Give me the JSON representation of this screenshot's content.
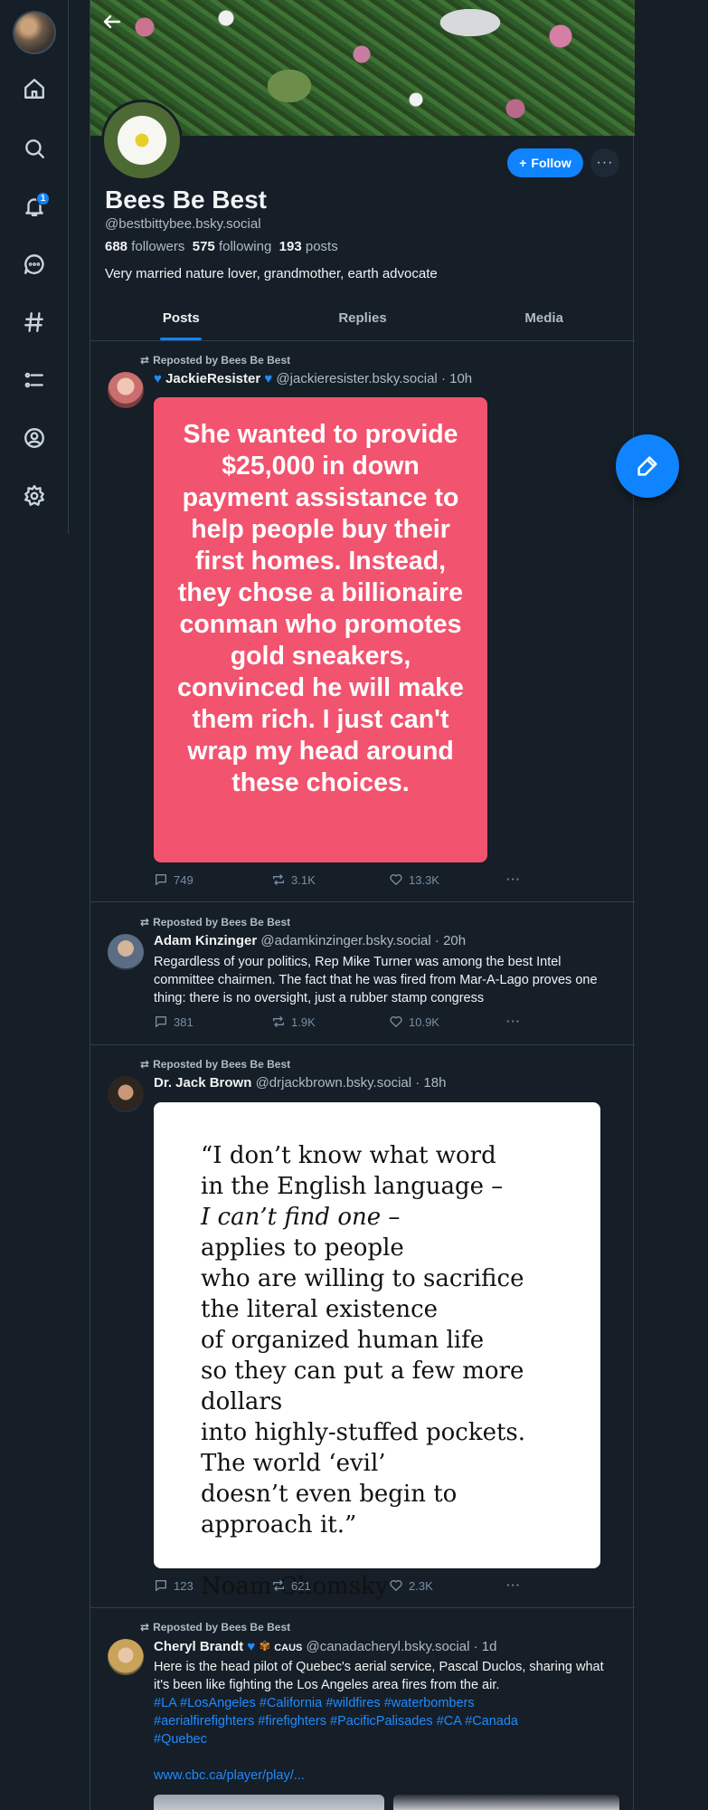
{
  "sidebar": {
    "notifications_count": "1"
  },
  "profile": {
    "display_name": "Bees Be Best",
    "handle": "@bestbittybee.bsky.social",
    "followers_count": "688",
    "followers_label": "followers",
    "following_count": "575",
    "following_label": "following",
    "posts_count": "193",
    "posts_label": "posts",
    "bio": "Very married nature lover, grandmother, earth advocate",
    "follow_label": "Follow",
    "more_label": "···"
  },
  "tabs": [
    "Posts",
    "Replies",
    "Media"
  ],
  "repost_label": "Reposted by Bees Be Best",
  "posts": [
    {
      "name": "JackieResister",
      "handle": "@jackieresister.bsky.social",
      "time": "· 10h",
      "image_text": "She wanted to provide $25,000 in down payment assistance to help people buy their first homes. Instead, they chose a billionaire conman who promotes gold sneakers, convinced he will make them rich. I just can't wrap my head around these choices.",
      "replies": "749",
      "reposts": "3.1K",
      "likes": "13.3K"
    },
    {
      "name": "Adam Kinzinger",
      "handle": "@adamkinzinger.bsky.social",
      "time": "· 20h",
      "text": "Regardless of your politics, Rep Mike Turner was among the best Intel committee chairmen.  The fact that he was fired from Mar-A-Lago proves one thing:  there is no oversight, just a rubber stamp congress",
      "replies": "381",
      "reposts": "1.9K",
      "likes": "10.9K"
    },
    {
      "name": "Dr. Jack Brown",
      "handle": "@drjackbrown.bsky.social",
      "time": "· 18h",
      "quote_lines": [
        "“I don’t know what word",
        "in the English language –",
        "I can’t find one –",
        "applies to people",
        "who are willing to sacrifice",
        "the literal existence",
        "of organized human life",
        "so they can put a few more dollars",
        "into highly-stuffed pockets.",
        "The world ‘evil’",
        "doesn’t even begin to approach it.”"
      ],
      "quote_author": "Noam Chomsky",
      "replies": "123",
      "reposts": "621",
      "likes": "2.3K"
    },
    {
      "name": "Cheryl Brandt",
      "name_suffix": "CAUS",
      "handle": "@canadacheryl.bsky.social",
      "time": "· 1d",
      "text": "Here is the head pilot of Quebec's aerial service, Pascal Duclos, sharing what it's been like fighting the Los Angeles area fires from the air.",
      "tags_line1": "#LA #LosAngeles  #California #wildfires #waterbombers",
      "tags_line2": "#aerialfirefighters #firefighters #PacificPalisades #CA #Canada",
      "tags_line3": "#Quebec",
      "link": "www.cbc.ca/player/play/..."
    }
  ]
}
